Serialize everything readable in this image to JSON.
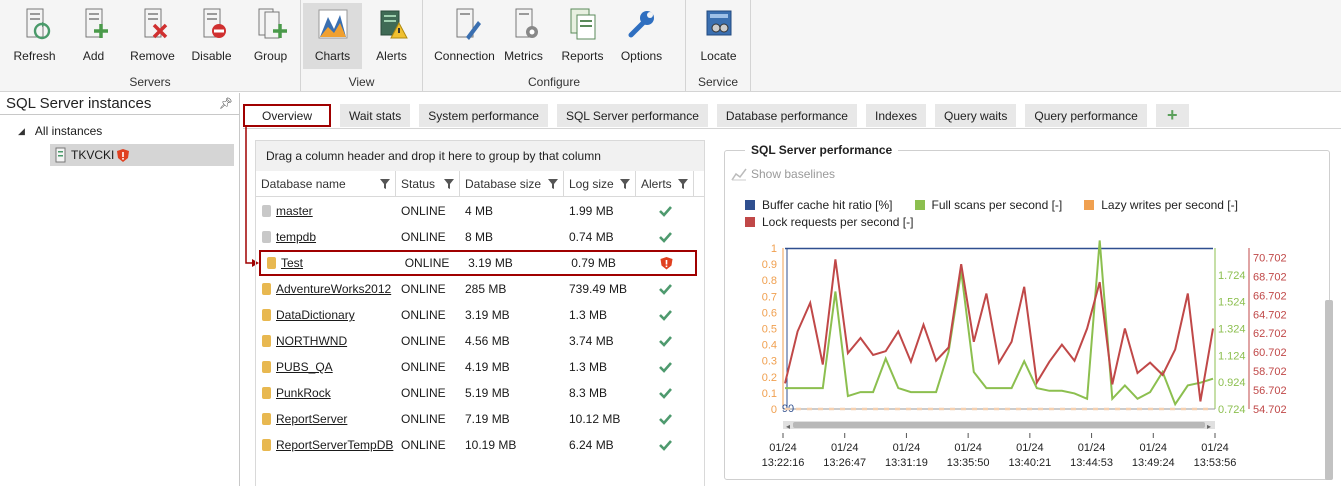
{
  "ribbon": {
    "groups": [
      {
        "label": "Servers",
        "buttons": [
          "Refresh",
          "Add",
          "Remove",
          "Disable",
          "Group"
        ]
      },
      {
        "label": "View",
        "buttons": [
          "Charts",
          "Alerts"
        ]
      },
      {
        "label": "Configure",
        "buttons": [
          "Connection",
          "Metrics",
          "Reports",
          "Options"
        ]
      },
      {
        "label": "Service",
        "buttons": [
          "Locate"
        ]
      }
    ]
  },
  "left_panel": {
    "title": "SQL Server instances",
    "tree": {
      "root": "All instances",
      "child": "TKVCKI"
    }
  },
  "tabs": [
    "Overview",
    "Wait stats",
    "System performance",
    "SQL Server performance",
    "Database performance",
    "Indexes",
    "Query waits",
    "Query performance"
  ],
  "grid": {
    "group_hint": "Drag a column header and drop it here to group by that column",
    "columns": [
      "Database name",
      "Status",
      "Database size",
      "Log size",
      "Alerts"
    ],
    "rows": [
      {
        "name": "master",
        "status": "ONLINE",
        "size": "4 MB",
        "log": "1.99 MB",
        "alert": "ok",
        "system": true
      },
      {
        "name": "tempdb",
        "status": "ONLINE",
        "size": "8 MB",
        "log": "0.74 MB",
        "alert": "ok",
        "system": true
      },
      {
        "name": "Test",
        "status": "ONLINE",
        "size": "3.19 MB",
        "log": "0.79 MB",
        "alert": "warn",
        "system": false
      },
      {
        "name": "AdventureWorks2012",
        "status": "ONLINE",
        "size": "285 MB",
        "log": "739.49 MB",
        "alert": "ok",
        "system": false
      },
      {
        "name": "DataDictionary",
        "status": "ONLINE",
        "size": "3.19 MB",
        "log": "1.3 MB",
        "alert": "ok",
        "system": false
      },
      {
        "name": "NORTHWND",
        "status": "ONLINE",
        "size": "4.56 MB",
        "log": "3.74 MB",
        "alert": "ok",
        "system": false
      },
      {
        "name": "PUBS_QA",
        "status": "ONLINE",
        "size": "4.19 MB",
        "log": "1.3 MB",
        "alert": "ok",
        "system": false
      },
      {
        "name": "PunkRock",
        "status": "ONLINE",
        "size": "5.19 MB",
        "log": "8.3 MB",
        "alert": "ok",
        "system": false
      },
      {
        "name": "ReportServer",
        "status": "ONLINE",
        "size": "7.19 MB",
        "log": "10.12 MB",
        "alert": "ok",
        "system": false
      },
      {
        "name": "ReportServerTempDB",
        "status": "ONLINE",
        "size": "10.19 MB",
        "log": "6.24 MB",
        "alert": "ok",
        "system": false
      }
    ]
  },
  "chart_panel": {
    "title": "SQL Server performance",
    "show_baselines": "Show baselines"
  },
  "colors": {
    "accent_red": "#a00000",
    "ok_green": "#4e9a6e",
    "blue": "#2f4f8f",
    "green": "#8cbf4f",
    "orange": "#f0a050",
    "red": "#c04848"
  },
  "chart_data": {
    "type": "line",
    "series": [
      {
        "name": "Buffer cache hit ratio [%]",
        "color": "#2f4f8f",
        "axis": "left-blue",
        "values": [
          100,
          100,
          100,
          100,
          100,
          100,
          100,
          100,
          100,
          100,
          100,
          100,
          100,
          100,
          100,
          100,
          100,
          100,
          100,
          100,
          100,
          100,
          100,
          100,
          100,
          100,
          100,
          100,
          100,
          100,
          100,
          100,
          100,
          100,
          100
        ]
      },
      {
        "name": "Full scans per second [-]",
        "color": "#8cbf4f",
        "axis": "right-green",
        "values": [
          0.88,
          0.88,
          0.88,
          0.88,
          1.6,
          0.82,
          0.85,
          0.85,
          1.1,
          0.88,
          0.85,
          0.85,
          0.85,
          1.15,
          1.75,
          1.0,
          0.88,
          0.88,
          0.88,
          1.08,
          0.88,
          0.86,
          0.86,
          0.84,
          0.8,
          1.98,
          0.8,
          0.9,
          0.8,
          0.85,
          1.0,
          0.76,
          0.9,
          0.92,
          0.95
        ]
      },
      {
        "name": "Lazy writes per second [-]",
        "color": "#f0a050",
        "axis": "left-orange",
        "values": [
          0,
          0,
          0,
          0,
          0,
          0,
          0,
          0,
          0,
          0,
          0,
          0,
          0,
          0,
          0,
          0,
          0,
          0,
          0,
          0,
          0,
          0,
          0,
          0,
          0,
          0,
          0,
          0,
          0,
          0,
          0,
          0,
          0,
          0,
          0
        ]
      },
      {
        "name": "Lock requests per second [-]",
        "color": "#c04848",
        "axis": "right-red",
        "values": [
          57.4,
          62.9,
          65.9,
          59.4,
          70.5,
          60.6,
          62.2,
          60.4,
          60.8,
          62.9,
          59.7,
          63.6,
          59.8,
          61.2,
          70.0,
          61.8,
          66.9,
          59.6,
          61.8,
          67.6,
          57.5,
          59.7,
          61.5,
          59.8,
          63.2,
          68.1,
          57.3,
          63.2,
          58.5,
          59.6,
          58.3,
          61.0,
          66.9,
          55.5,
          63.2
        ]
      }
    ],
    "left_axis_ticks": [
      "1",
      "0.9",
      "0.8",
      "0.7",
      "0.6",
      "0.5",
      "0.4",
      "0.3",
      "0.2",
      "0.1",
      "0"
    ],
    "left_blue_tick": "90",
    "right_green_ticks": [
      "1.724",
      "1.524",
      "1.324",
      "1.124",
      "0.924",
      "0.724"
    ],
    "right_red_ticks": [
      "70.702",
      "68.702",
      "66.702",
      "64.702",
      "62.702",
      "60.702",
      "58.702",
      "56.702",
      "54.702"
    ],
    "x_ticks": [
      {
        "date": "01/24",
        "time": "13:22:16"
      },
      {
        "date": "01/24",
        "time": "13:26:47"
      },
      {
        "date": "01/24",
        "time": "13:31:19"
      },
      {
        "date": "01/24",
        "time": "13:35:50"
      },
      {
        "date": "01/24",
        "time": "13:40:21"
      },
      {
        "date": "01/24",
        "time": "13:44:53"
      },
      {
        "date": "01/24",
        "time": "13:49:24"
      },
      {
        "date": "01/24",
        "time": "13:53:56"
      }
    ],
    "legend_placement": "top",
    "grid": false
  }
}
